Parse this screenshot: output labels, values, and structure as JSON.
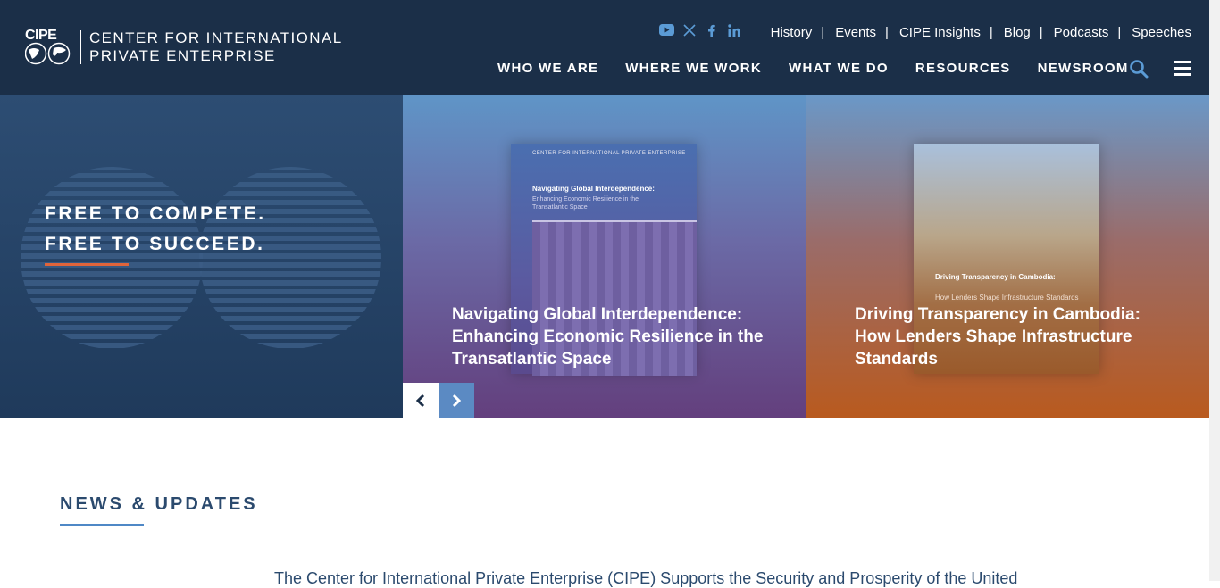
{
  "logo": {
    "wordmark": "CIPE",
    "line1": "CENTER FOR INTERNATIONAL",
    "line2": "PRIVATE ENTERPRISE"
  },
  "social": [
    "youtube-icon",
    "x-icon",
    "facebook-icon",
    "linkedin-icon"
  ],
  "utility_nav": [
    "History",
    "Events",
    "CIPE Insights",
    "Blog",
    "Podcasts",
    "Speeches"
  ],
  "main_nav": [
    "WHO WE ARE",
    "WHERE WE WORK",
    "WHAT WE DO",
    "RESOURCES",
    "NEWSROOM"
  ],
  "hero": {
    "tagline_line1": "FREE TO COMPETE.",
    "tagline_line2": "FREE TO SUCCEED.",
    "slides": [
      {
        "title": "Navigating Global Interdependence: Enhancing Economic Resilience in the Transatlantic Space",
        "cover_org": "CENTER FOR INTERNATIONAL PRIVATE ENTERPRISE",
        "cover_title": "Navigating Global Interdependence:",
        "cover_subtitle": "Enhancing Economic Resilience in the Transatlantic Space"
      },
      {
        "title": "Driving Transparency in Cambodia: How Lenders Shape Infrastructure Standards",
        "cover_title": "Driving Transparency in Cambodia:",
        "cover_subtitle": "How Lenders Shape Infrastructure Standards"
      }
    ]
  },
  "news": {
    "heading": "NEWS & UPDATES",
    "first_item": "The Center for International Private Enterprise (CIPE) Supports the Security and Prosperity of the United"
  },
  "colors": {
    "header_bg": "#1b2f48",
    "accent_orange": "#e0643a",
    "accent_blue": "#4f88c6"
  }
}
